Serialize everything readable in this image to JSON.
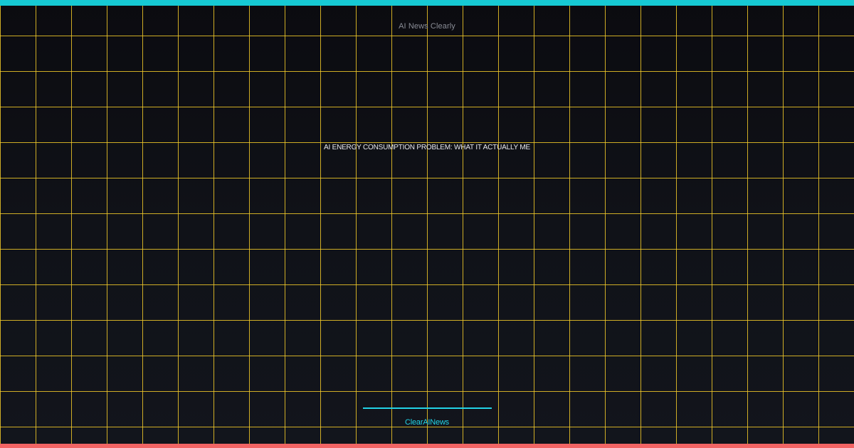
{
  "site": {
    "name_top": "AI News Clearly",
    "name_bottom": "ClearAINews"
  },
  "headline": "AI ENERGY CONSUMPTION PROBLEM: WHAT IT ACTUALLY ME",
  "colors": {
    "top_bar": "#16c9d3",
    "bottom_bar": "#f26464",
    "accent": "#22d3e6",
    "grid": "#f0c828"
  }
}
